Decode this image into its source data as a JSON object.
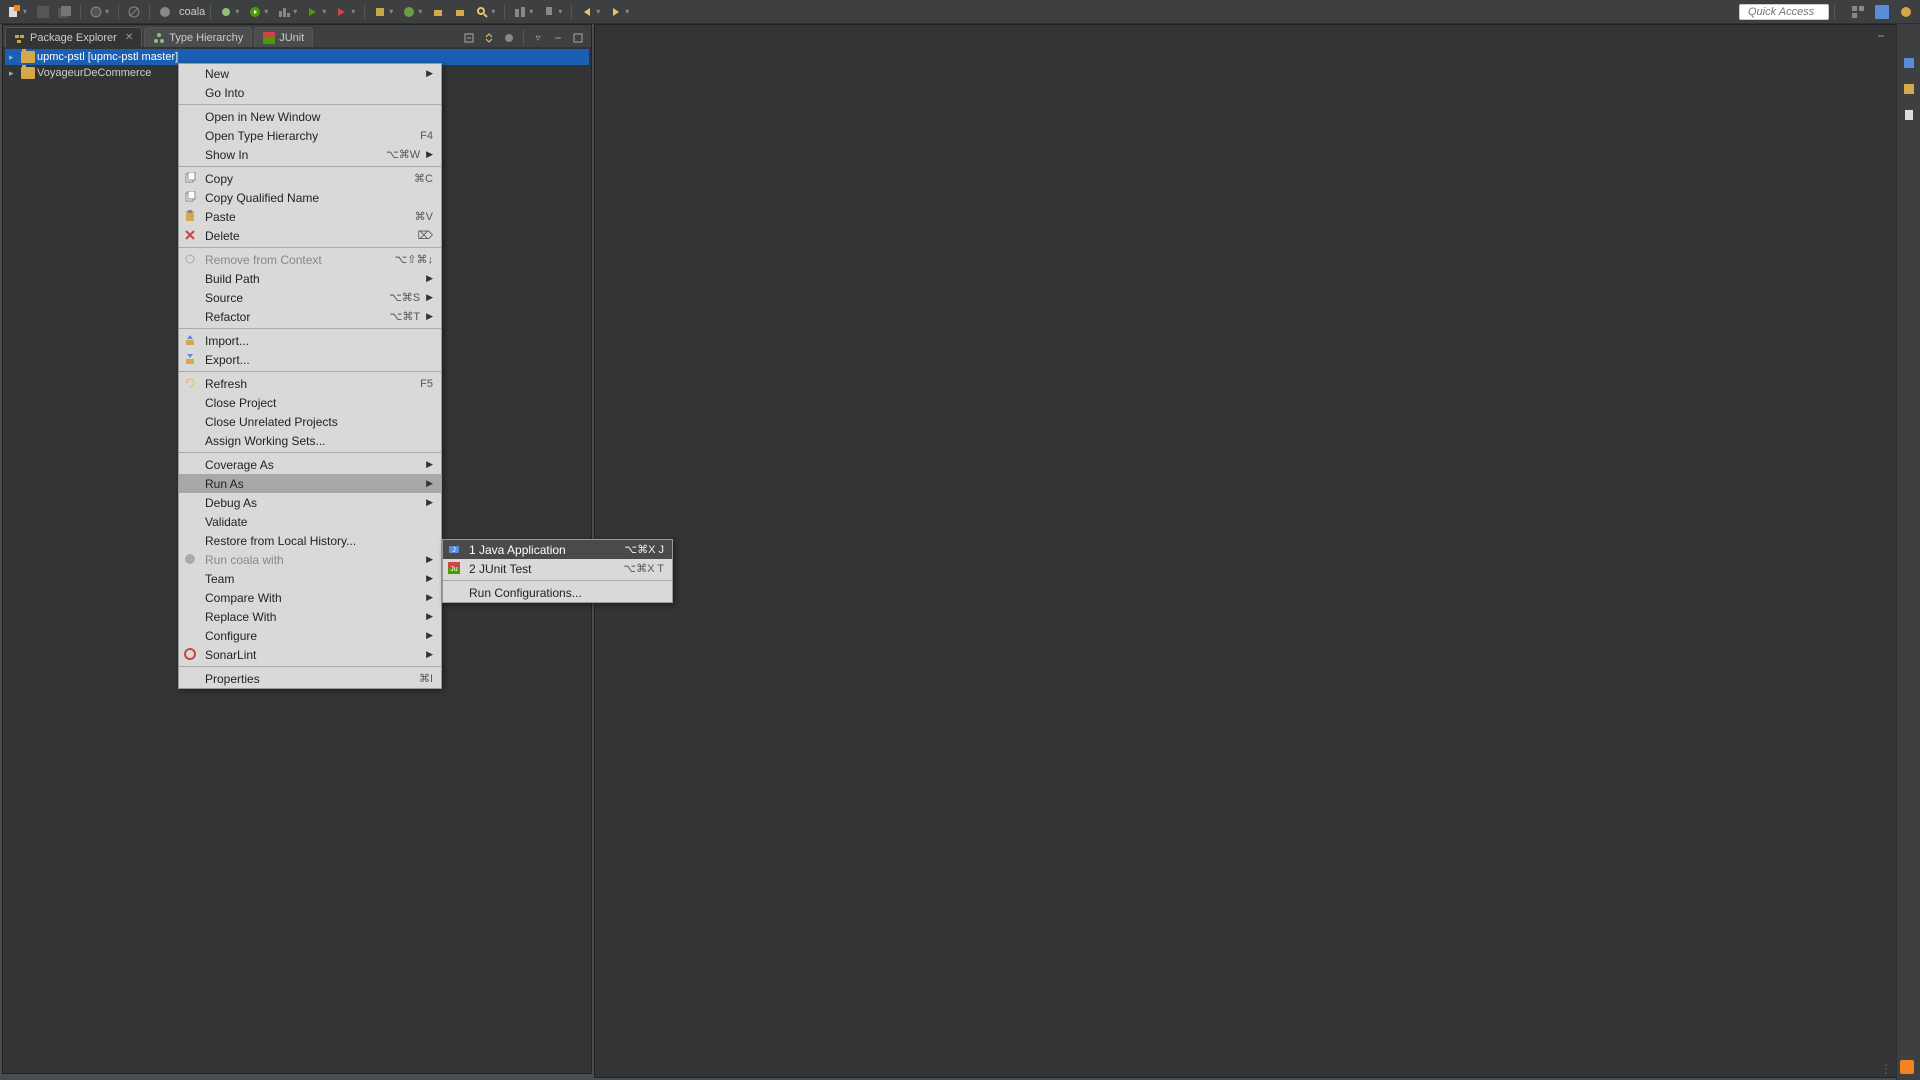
{
  "quick_access_placeholder": "Quick Access",
  "coala_label": "coala",
  "tabs": [
    {
      "label": "Package Explorer",
      "active": true,
      "closeable": true
    },
    {
      "label": "Type Hierarchy",
      "active": false,
      "closeable": false
    },
    {
      "label": "JUnit",
      "active": false,
      "closeable": false
    }
  ],
  "projects": [
    {
      "label": "upmc-pstl [upmc-pstl master]",
      "selected": true
    },
    {
      "label": "VoyageurDeCommerce",
      "selected": false
    }
  ],
  "context_menu": [
    {
      "label": "New",
      "arrow": true
    },
    {
      "label": "Go Into"
    },
    {
      "sep": true
    },
    {
      "label": "Open in New Window"
    },
    {
      "label": "Open Type Hierarchy",
      "shortcut": "F4"
    },
    {
      "label": "Show In",
      "shortcut": "⌥⌘W",
      "arrow": true
    },
    {
      "sep": true
    },
    {
      "icon": "copy",
      "label": "Copy",
      "shortcut": "⌘C"
    },
    {
      "icon": "copy-q",
      "label": "Copy Qualified Name"
    },
    {
      "icon": "paste",
      "label": "Paste",
      "shortcut": "⌘V"
    },
    {
      "icon": "delete",
      "label": "Delete",
      "shortcut": "⌦"
    },
    {
      "sep": true
    },
    {
      "icon": "remove",
      "label": "Remove from Context",
      "shortcut": "⌥⇧⌘↓",
      "disabled": true
    },
    {
      "label": "Build Path",
      "arrow": true
    },
    {
      "label": "Source",
      "shortcut": "⌥⌘S",
      "arrow": true
    },
    {
      "label": "Refactor",
      "shortcut": "⌥⌘T",
      "arrow": true
    },
    {
      "sep": true
    },
    {
      "icon": "import",
      "label": "Import..."
    },
    {
      "icon": "export",
      "label": "Export..."
    },
    {
      "sep": true
    },
    {
      "icon": "refresh",
      "label": "Refresh",
      "shortcut": "F5"
    },
    {
      "label": "Close Project"
    },
    {
      "label": "Close Unrelated Projects"
    },
    {
      "label": "Assign Working Sets..."
    },
    {
      "sep": true
    },
    {
      "label": "Coverage As",
      "arrow": true
    },
    {
      "label": "Run As",
      "arrow": true,
      "highlight": true
    },
    {
      "label": "Debug As",
      "arrow": true
    },
    {
      "label": "Validate"
    },
    {
      "label": "Restore from Local History..."
    },
    {
      "icon": "coala",
      "label": "Run coala with",
      "arrow": true,
      "disabled": true
    },
    {
      "label": "Team",
      "arrow": true
    },
    {
      "label": "Compare With",
      "arrow": true
    },
    {
      "label": "Replace With",
      "arrow": true
    },
    {
      "label": "Configure",
      "arrow": true
    },
    {
      "icon": "sonarlint",
      "label": "SonarLint",
      "arrow": true
    },
    {
      "sep": true
    },
    {
      "label": "Properties",
      "shortcut": "⌘I"
    }
  ],
  "submenu": [
    {
      "icon": "java",
      "label": "1 Java Application",
      "shortcut": "⌥⌘X J",
      "highlight": true
    },
    {
      "icon": "junit",
      "label": "2 JUnit Test",
      "shortcut": "⌥⌘X T"
    },
    {
      "sep": true
    },
    {
      "label": "Run Configurations..."
    }
  ]
}
